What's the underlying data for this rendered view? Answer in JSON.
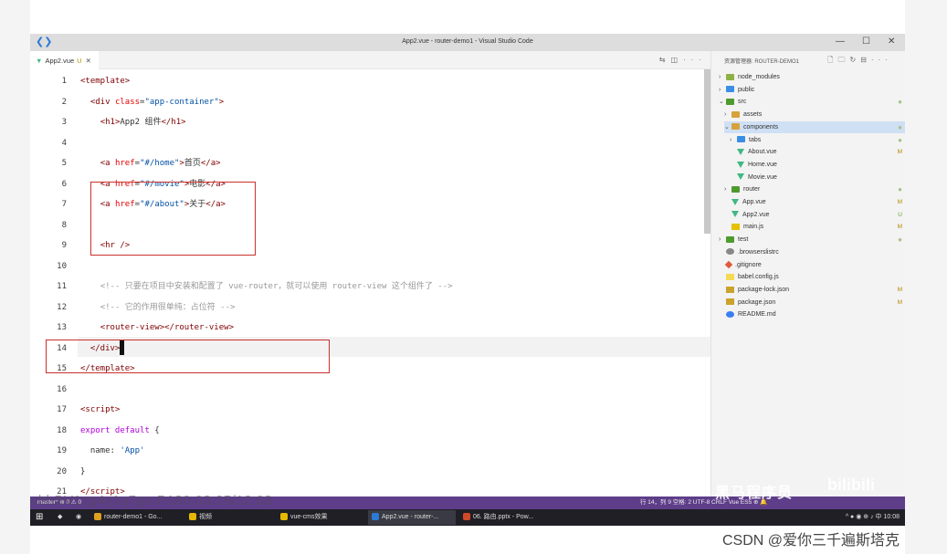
{
  "window": {
    "title": "App2.vue - router-demo1 - Visual Studio Code",
    "minimize": "—",
    "maximize": "☐",
    "close": "✕"
  },
  "tab": {
    "name": "App2.vue",
    "status": "U",
    "close": "✕"
  },
  "explorer": {
    "header": "资源管理器: ROUTER-DEMO1",
    "items": [
      {
        "label": "node_modules",
        "chev": "›",
        "icon": "fg",
        "status": "",
        "stype": ""
      },
      {
        "label": "public",
        "chev": "›",
        "icon": "fb",
        "status": "",
        "stype": ""
      },
      {
        "label": "src",
        "chev": "⌄",
        "icon": "fr",
        "status": "●",
        "stype": "dot"
      },
      {
        "label": "assets",
        "chev": "›",
        "icon": "fd",
        "status": "",
        "stype": ""
      },
      {
        "label": "components",
        "chev": "⌄",
        "icon": "fd",
        "status": "●",
        "stype": "dot"
      },
      {
        "label": "tabs",
        "chev": "›",
        "icon": "fb",
        "status": "●",
        "stype": "dot"
      },
      {
        "label": "About.vue",
        "chev": "",
        "icon": "vue",
        "status": "M",
        "stype": "m"
      },
      {
        "label": "Home.vue",
        "chev": "",
        "icon": "vue",
        "status": "",
        "stype": ""
      },
      {
        "label": "Movie.vue",
        "chev": "",
        "icon": "vue",
        "status": "",
        "stype": ""
      },
      {
        "label": "router",
        "chev": "›",
        "icon": "fr",
        "status": "●",
        "stype": "dot"
      },
      {
        "label": "App.vue",
        "chev": "",
        "icon": "vue",
        "status": "M",
        "stype": "m"
      },
      {
        "label": "App2.vue",
        "chev": "",
        "icon": "vue",
        "status": "U",
        "stype": "u"
      },
      {
        "label": "main.js",
        "chev": "",
        "icon": "js",
        "status": "M",
        "stype": "m"
      },
      {
        "label": "test",
        "chev": "›",
        "icon": "fr",
        "status": "●",
        "stype": "dot"
      },
      {
        "label": ".browserslistrc",
        "chev": "",
        "icon": "gr",
        "status": "",
        "stype": ""
      },
      {
        "label": ".gitignore",
        "chev": "",
        "icon": "git",
        "status": "",
        "stype": ""
      },
      {
        "label": "babel.config.js",
        "chev": "",
        "icon": "bab",
        "status": "",
        "stype": ""
      },
      {
        "label": "package-lock.json",
        "chev": "",
        "icon": "json",
        "status": "M",
        "stype": "m"
      },
      {
        "label": "package.json",
        "chev": "",
        "icon": "json",
        "status": "M",
        "stype": "m"
      },
      {
        "label": "README.md",
        "chev": "",
        "icon": "md",
        "status": "",
        "stype": ""
      }
    ]
  },
  "code": [
    {
      "n": "1",
      "html": "<span class='tg'>&lt;template&gt;</span>"
    },
    {
      "n": "2",
      "html": "  <span class='tg'>&lt;div</span> <span class='at'>class</span>=<span class='st'>\"app-container\"</span><span class='tg'>&gt;</span>"
    },
    {
      "n": "3",
      "html": "    <span class='tg'>&lt;h1&gt;</span>App2 组件<span class='tg'>&lt;/h1&gt;</span>"
    },
    {
      "n": "4",
      "html": ""
    },
    {
      "n": "5",
      "html": "    <span class='tg'>&lt;a</span> <span class='at'>href</span>=<span class='st'>\"#/home\"</span><span class='tg'>&gt;</span>首页<span class='tg'>&lt;/a&gt;</span>"
    },
    {
      "n": "6",
      "html": "    <span class='tg'>&lt;a</span> <span class='at'>href</span>=<span class='st'>\"#/movie\"</span><span class='tg'>&gt;</span>电影<span class='tg'>&lt;/a&gt;</span>"
    },
    {
      "n": "7",
      "html": "    <span class='tg'>&lt;a</span> <span class='at'>href</span>=<span class='st'>\"#/about\"</span><span class='tg'>&gt;</span>关于<span class='tg'>&lt;/a&gt;</span>"
    },
    {
      "n": "8",
      "html": ""
    },
    {
      "n": "9",
      "html": "    <span class='tg'>&lt;hr /&gt;</span>"
    },
    {
      "n": "10",
      "html": ""
    },
    {
      "n": "11",
      "html": "    <span class='cm'>&lt;!-- 只要在项目中安装和配置了 vue-router，就可以使用 router-view 这个组件了 --&gt;</span>"
    },
    {
      "n": "12",
      "html": "    <span class='cm'>&lt;!-- 它的作用很单纯：占位符 --&gt;</span>"
    },
    {
      "n": "13",
      "html": "    <span class='tg'>&lt;router-view&gt;&lt;/router-view&gt;</span>"
    },
    {
      "n": "14",
      "html": "  <span class='tg'>&lt;/div&gt;</span><span class='cursor'></span>"
    },
    {
      "n": "15",
      "html": "<span class='tg'>&lt;/template&gt;</span>"
    },
    {
      "n": "16",
      "html": ""
    },
    {
      "n": "17",
      "html": "<span class='tg'>&lt;script&gt;</span>"
    },
    {
      "n": "18",
      "html": "<span class='kw'>export default</span> {"
    },
    {
      "n": "19",
      "html": "  name: <span class='st'>'App'</span>"
    },
    {
      "n": "20",
      "html": "}"
    },
    {
      "n": "21",
      "html": "<span class='tg'>&lt;/script&gt;</span>"
    }
  ],
  "statusbar": {
    "left": "master*  ⊗ 0 ⚠ 0",
    "right": "行 14，列 9   空格: 2   UTF-8   CRLF   Vue   ES5   ⊕ 🔔"
  },
  "watermark": "uhhBV1zg4y1q7ga P180 03:25/12:03",
  "watermark2": "黑马程序员",
  "watermark3": "bilibili",
  "taskbar": {
    "items": [
      {
        "label": "router-demo1 - Go...",
        "color": "#e0a020"
      },
      {
        "label": "视频",
        "color": "#e6b800"
      },
      {
        "label": "vue-cms效果",
        "color": "#e6b800"
      },
      {
        "label": "App2.vue - router-...",
        "color": "#2b7bd6"
      },
      {
        "label": "06. 路由.pptx - Pow...",
        "color": "#d04a2a"
      }
    ],
    "tray": "^ ● ◉ ⊕ ♪ 中  10:08"
  },
  "footer": "CSDN @爱你三千遍斯塔克"
}
